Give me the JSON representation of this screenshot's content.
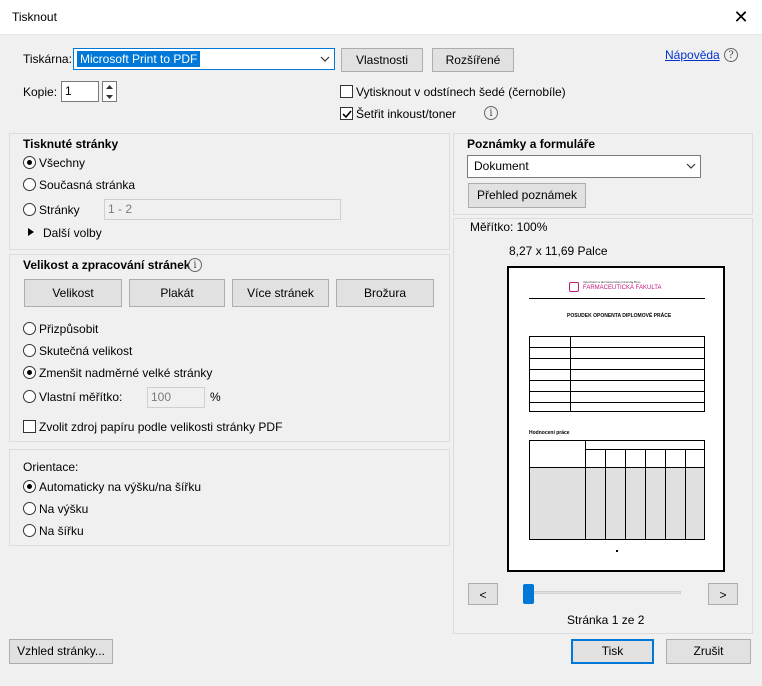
{
  "window": {
    "title": "Tisknout"
  },
  "printer": {
    "label": "Tiskárna:",
    "selected": "Microsoft Print to PDF",
    "properties_button": "Vlastnosti",
    "advanced_button": "Rozšířené",
    "help_link": "Nápověda"
  },
  "copies": {
    "label": "Kopie:",
    "value": "1"
  },
  "options": {
    "grayscale": {
      "label": "Vytisknout v odstínech šedé (černobíle)",
      "checked": false
    },
    "save_ink": {
      "label": "Šetřit inkoust/toner",
      "checked": true
    }
  },
  "pages": {
    "heading": "Tisknuté stránky",
    "all": "Všechny",
    "current": "Současná stránka",
    "range": "Stránky",
    "range_placeholder": "1 - 2",
    "more": "Další volby",
    "selected": "all"
  },
  "sizing": {
    "heading": "Velikost a zpracování stránek",
    "tabs": [
      "Velikost",
      "Plakát",
      "Více stránek",
      "Brožura"
    ],
    "fit": "Přizpůsobit",
    "actual": "Skutečná velikost",
    "shrink": "Zmenšit nadměrné velké stránky",
    "custom": "Vlastní měřítko:",
    "custom_value": "100",
    "percent": "%",
    "paper_source": "Zvolit zdroj papíru podle velikosti stránky PDF",
    "selected": "shrink"
  },
  "orientation": {
    "heading": "Orientace:",
    "auto": "Automaticky na výšku/na šířku",
    "portrait": "Na výšku",
    "landscape": "Na šířku",
    "selected": "auto"
  },
  "comments": {
    "heading": "Poznámky a formuláře",
    "selected": "Dokument",
    "summary_button": "Přehled poznámek"
  },
  "preview": {
    "scale": "Měřítko: 100%",
    "size": "8,27 x 11,69 Palce",
    "page_status": "Stránka 1 ze 2",
    "prev": "<",
    "next": ">",
    "slider_position": 0.0,
    "doc": {
      "university": "Veterinární a farmaceutická univerzita Brno",
      "faculty": "FARMACEUTICKÁ FAKULTA",
      "title": "POSUDEK OPONENTA DIPLOMOVÉ PRÁCE",
      "section": "Hodnocení práce"
    }
  },
  "footer": {
    "page_setup": "Vzhled stránky...",
    "print": "Tisk",
    "cancel": "Zrušit"
  },
  "colors": {
    "accent": "#0078d7",
    "link": "#0033cc",
    "faculty_pink": "#c2187a"
  }
}
